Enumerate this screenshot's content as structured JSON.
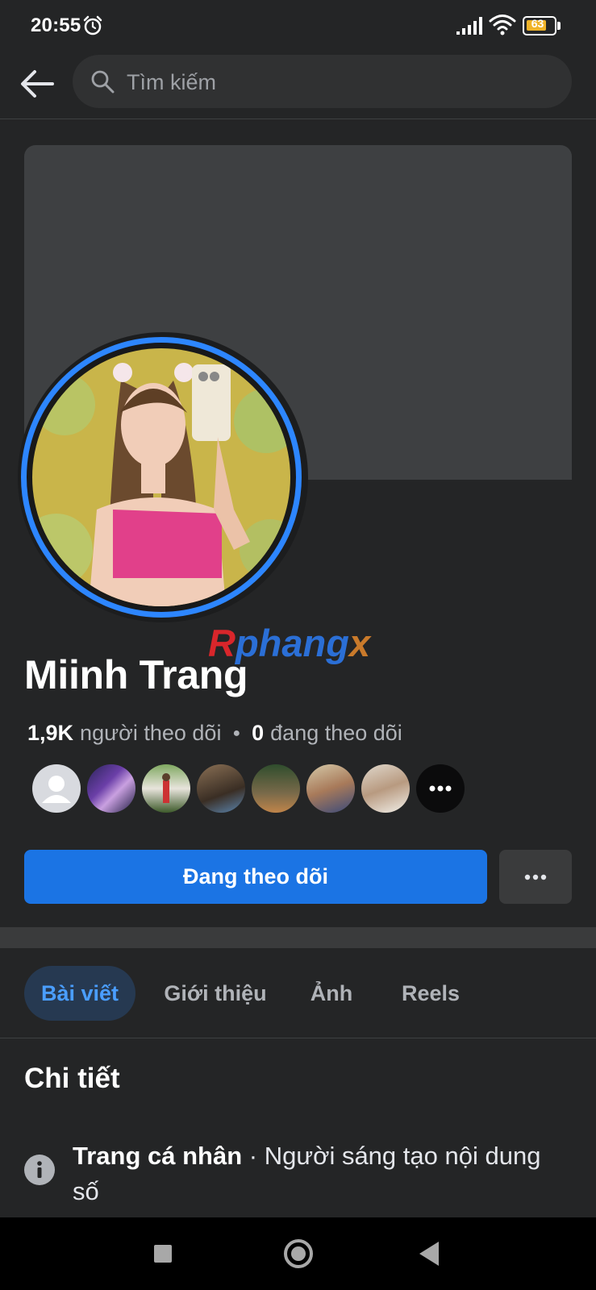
{
  "status_bar": {
    "time": "20:55",
    "battery": "63"
  },
  "search": {
    "placeholder": "Tìm kiếm"
  },
  "profile": {
    "name": "Miinh Trang",
    "followers_count": "1,9K",
    "followers_label": "người theo dõi",
    "following_count": "0",
    "following_label": "đang theo dõi"
  },
  "watermark": {
    "part1": "R",
    "part2": "phang",
    "part3": "x"
  },
  "friends": [
    "default-avatar",
    "photo",
    "photo",
    "photo",
    "photo",
    "photo",
    "photo",
    "more"
  ],
  "actions": {
    "follow_label": "Đang theo dõi"
  },
  "tabs": [
    {
      "label": "Bài viết",
      "active": true
    },
    {
      "label": "Giới thiệu",
      "active": false
    },
    {
      "label": "Ảnh",
      "active": false
    },
    {
      "label": "Reels",
      "active": false
    }
  ],
  "details": {
    "title": "Chi tiết",
    "type_label": "Trang cá nhân",
    "separator": " · ",
    "type_value": "Người sáng tạo nội dung số"
  },
  "colors": {
    "accent": "#1b74e4",
    "active_tab_text": "#4a9eff",
    "ring": "#2d86ff"
  }
}
